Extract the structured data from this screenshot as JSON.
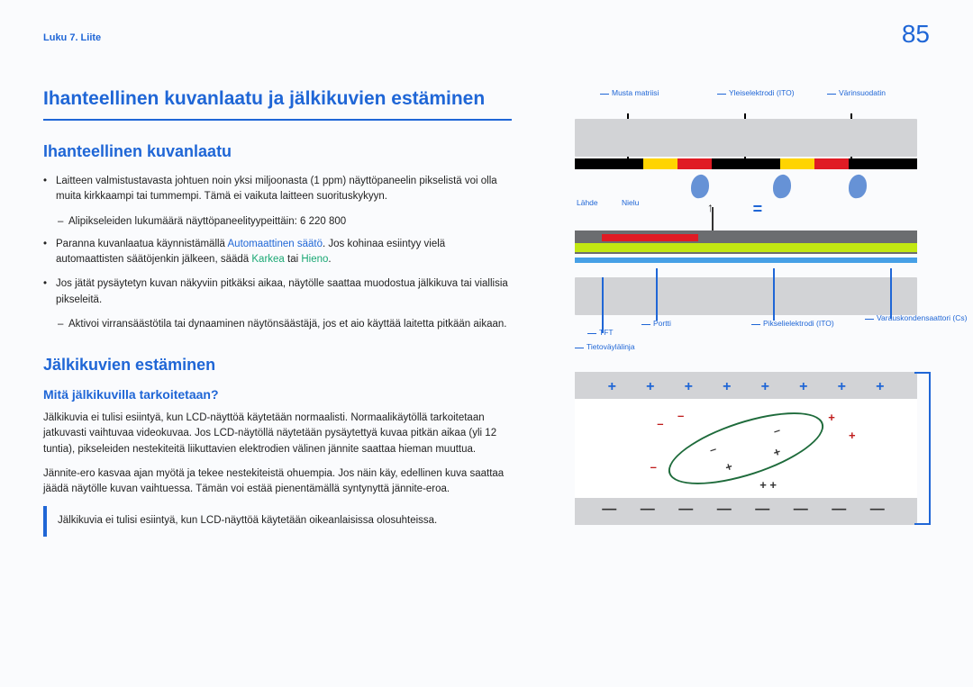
{
  "chapter": "Luku 7. Liite",
  "page_number": "85",
  "main_title": "Ihanteellinen kuvanlaatu ja jälkikuvien estäminen",
  "section1": {
    "title": "Ihanteellinen kuvanlaatu",
    "item1": "Laitteen valmistustavasta johtuen noin yksi miljoonasta (1 ppm) näyttöpaneelin pikselistä voi olla muita kirkkaampi tai tummempi. Tämä ei vaikuta laitteen suorituskykyyn.",
    "sub1": "Alipikseleiden lukumäärä näyttöpaneelityypeittäin: 6 220 800",
    "item2_a": "Paranna kuvanlaatua käynnistämällä ",
    "item2_b": "Automaattinen säätö",
    "item2_c": ". Jos kohinaa esiintyy vielä automaattisten säätöjenkin jälkeen, säädä ",
    "item2_d": "Karkea",
    "item2_e": " tai ",
    "item2_f": "Hieno",
    "item2_g": ".",
    "item3": "Jos jätät pysäytetyn kuvan näkyviin pitkäksi aikaa, näytölle saattaa muodostua jälkikuva tai viallisia pikseleitä.",
    "sub3": "Aktivoi virransäästötila tai dynaaminen näytönsäästäjä, jos et aio käyttää laitetta pitkään aikaan."
  },
  "section2": {
    "title": "Jälkikuvien estäminen",
    "subtitle": "Mitä jälkikuvilla tarkoitetaan?",
    "p1": "Jälkikuvia ei tulisi esiintyä, kun LCD-näyttöä käytetään normaalisti. Normaalikäytöllä tarkoitetaan jatkuvasti vaihtuvaa videokuvaa. Jos LCD-näytöllä näytetään pysäytettyä kuvaa pitkän aikaa (yli 12 tuntia), pikseleiden nestekiteitä liikuttavien elektrodien välinen jännite saattaa hieman muuttua.",
    "p2": "Jännite-ero kasvaa ajan myötä ja tekee nestekiteistä ohuempia. Jos näin käy, edellinen kuva saattaa jäädä näytölle kuvan vaihtuessa. Tämän voi estää pienentämällä syntynyttä jännite-eroa.",
    "note": "Jälkikuvia ei tulisi esiintyä, kun LCD-näyttöä käytetään oikeanlaisissa olosuhteissa."
  },
  "diagram_labels": {
    "black_matrix": "Musta matriisi",
    "common_electrode": "Yleiselektrodi (ITO)",
    "color_filter": "Värinsuodatin",
    "source": "Lähde",
    "drain": "Nielu",
    "tft": "TFT",
    "gate": "Portti",
    "pixel_electrode": "Pikselielektrodi (ITO)",
    "storage_capacitor": "Varauskonden­saattori (Cs)",
    "data_line": "Tietoväylälinja"
  }
}
